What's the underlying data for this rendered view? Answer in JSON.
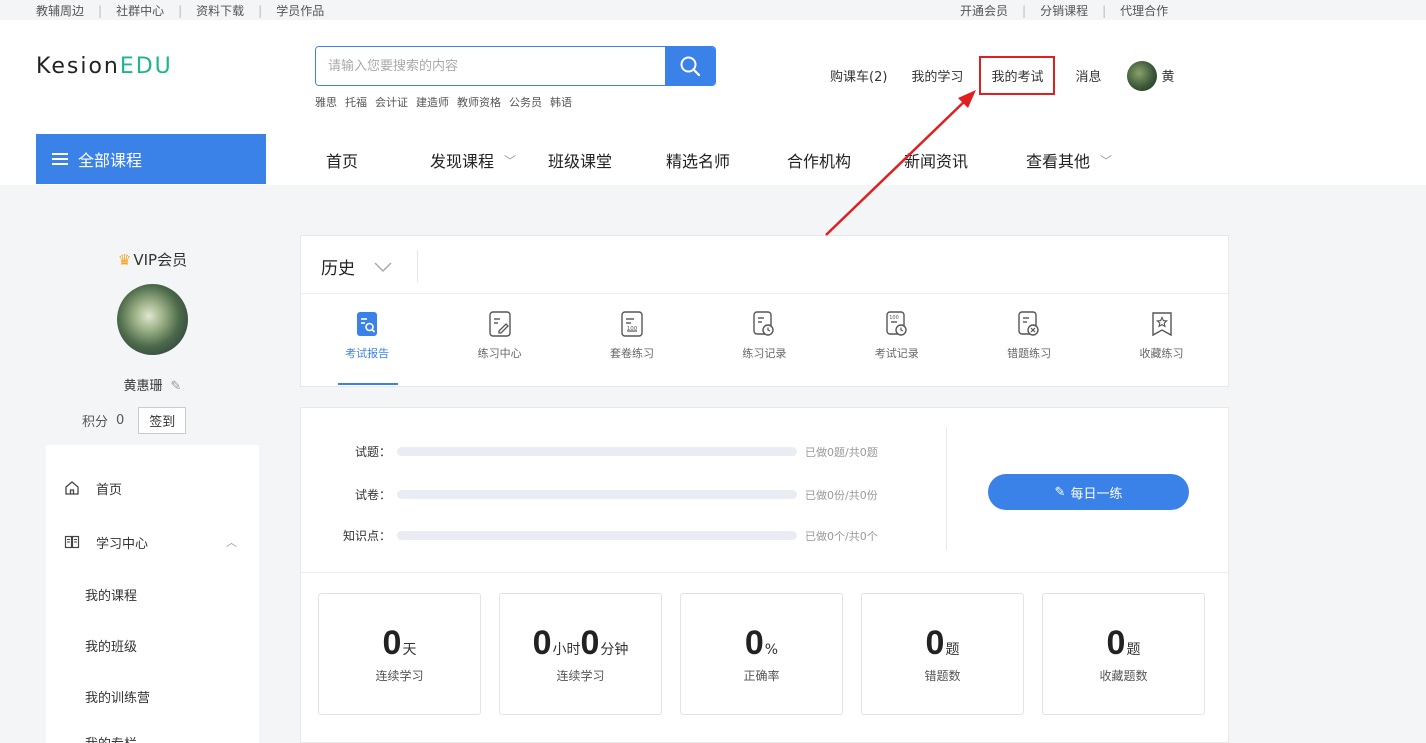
{
  "topbar": {
    "left_links": [
      "教辅周边",
      "社群中心",
      "资料下载",
      "学员作品"
    ],
    "right_links": [
      "开通会员",
      "分销课程",
      "代理合作"
    ],
    "separator": "|"
  },
  "logo": {
    "part1": "Kesion",
    "part2": "EDU"
  },
  "search": {
    "placeholder": "请输入您要搜索的内容",
    "hot_words": [
      "雅思",
      "托福",
      "会计证",
      "建造师",
      "教师资格",
      "公务员",
      "韩语"
    ]
  },
  "user_nav": {
    "cart": "购课车(2)",
    "my_study": "我的学习",
    "my_exam": "我的考试",
    "messages": "消息",
    "username": "黄"
  },
  "category_button": {
    "label": "全部课程"
  },
  "main_nav": [
    {
      "label": "首页",
      "dropdown": false
    },
    {
      "label": "发现课程",
      "dropdown": true
    },
    {
      "label": "班级课堂",
      "dropdown": false
    },
    {
      "label": "精选名师",
      "dropdown": false
    },
    {
      "label": "合作机构",
      "dropdown": false
    },
    {
      "label": "新闻资讯",
      "dropdown": false
    },
    {
      "label": "查看其他",
      "dropdown": true
    }
  ],
  "profile": {
    "vip_label": "VIP会员",
    "name": "黄惠珊",
    "points_label": "积分",
    "points_value": "0",
    "sign_in": "签到"
  },
  "side_menu": {
    "home": "首页",
    "study_center": "学习中心",
    "items": [
      "我的课程",
      "我的班级",
      "我的训练营",
      "我的专栏"
    ]
  },
  "subject": {
    "selected": "历史"
  },
  "tabs": [
    {
      "label": "考试报告",
      "icon": "exam-report-icon",
      "active": true
    },
    {
      "label": "练习中心",
      "icon": "practice-center-icon",
      "active": false
    },
    {
      "label": "套卷练习",
      "icon": "paper-set-icon",
      "active": false
    },
    {
      "label": "练习记录",
      "icon": "practice-record-icon",
      "active": false
    },
    {
      "label": "考试记录",
      "icon": "exam-record-icon",
      "active": false
    },
    {
      "label": "错题练习",
      "icon": "wrong-question-icon",
      "active": false
    },
    {
      "label": "收藏练习",
      "icon": "favorite-icon",
      "active": false
    }
  ],
  "progress": [
    {
      "label": "试题：",
      "text": "已做0题/共0题",
      "fraction": 0
    },
    {
      "label": "试卷：",
      "text": "已做0份/共0份",
      "fraction": 0
    },
    {
      "label": "知识点：",
      "text": "已做0个/共0个",
      "fraction": 0
    }
  ],
  "daily_button": "每日一练",
  "stats": [
    {
      "parts": [
        {
          "value": "0",
          "unit": "天"
        }
      ],
      "label": "连续学习"
    },
    {
      "parts": [
        {
          "value": "0",
          "unit": "小时"
        },
        {
          "value": "0",
          "unit": "分钟"
        }
      ],
      "label": "连续学习"
    },
    {
      "parts": [
        {
          "value": "0",
          "unit": "%"
        }
      ],
      "label": "正确率"
    },
    {
      "parts": [
        {
          "value": "0",
          "unit": "题"
        }
      ],
      "label": "错题数"
    },
    {
      "parts": [
        {
          "value": "0",
          "unit": "题"
        }
      ],
      "label": "收藏题数"
    }
  ],
  "colors": {
    "primary": "#3b82e8",
    "annotation": "#e02020",
    "logo_accent": "#1fb58f"
  }
}
